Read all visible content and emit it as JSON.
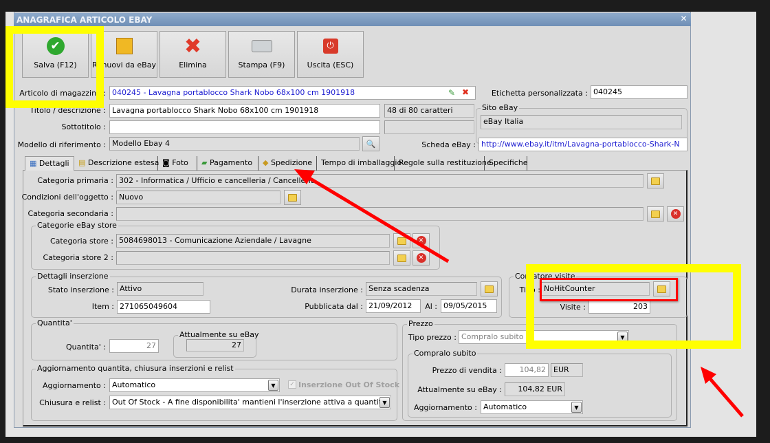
{
  "window": {
    "title": "ANAGRAFICA ARTICOLO EBAY",
    "close": "✕"
  },
  "toolbar": [
    {
      "label": "Salva (F12)",
      "icon": "check-icon"
    },
    {
      "label": "Rimuovi da eBay",
      "icon": "box-remove-icon"
    },
    {
      "label": "Elimina",
      "icon": "x-icon"
    },
    {
      "label": "Stampa (F9)",
      "icon": "printer-icon"
    },
    {
      "label": "Uscita (ESC)",
      "icon": "power-icon"
    }
  ],
  "header": {
    "articolo_label": "Articolo di magazzino :",
    "articolo_value": "040245 - Lavagna portablocco Shark Nobo 68x100 cm 1901918",
    "titolo_label": "Titolo / descrizione :",
    "titolo_value": "Lavagna portablocco Shark Nobo 68x100 cm 1901918",
    "titolo_count": "48 di 80 caratteri",
    "sottotitolo_label": "Sottotitolo :",
    "sottotitolo_value": "",
    "modello_label": "Modello di riferimento :",
    "modello_value": "Modello Ebay 4",
    "etichetta_label": "Etichetta personalizzata :",
    "etichetta_value": "040245",
    "sito_group": "Sito eBay",
    "sito_value": "eBay Italia",
    "scheda_label": "Scheda eBay :",
    "scheda_value": "http://www.ebay.it/itm/Lavagna-portablocco-Shark-N"
  },
  "tabs": [
    "Dettagli",
    "Descrizione estesa",
    "Foto",
    "Pagamento",
    "Spedizione",
    "Tempo di imballaggio",
    "Regole sulla restituzione",
    "Specifiche"
  ],
  "details": {
    "cat_primaria_label": "Categoria primaria :",
    "cat_primaria": "302 - Informatica / Ufficio e cancelleria / Cancelleria",
    "condizioni_label": "Condizioni dell'oggetto :",
    "condizioni": "Nuovo",
    "cat_secondaria_label": "Categoria secondaria :",
    "cat_secondaria": "",
    "store_group": "Categorie eBay store",
    "store_label": "Categoria store :",
    "store": "5084698013 - Comunicazione Aziendale / Lavagne",
    "store2_label": "Categoria store 2 :",
    "store2": "",
    "inserzione_group": "Dettagli inserzione",
    "stato_label": "Stato inserzione :",
    "stato": "Attivo",
    "item_label": "Item :",
    "item": "271065049604",
    "durata_label": "Durata inserzione :",
    "durata": "Senza scadenza",
    "pubblicata_label": "Pubblicata dal :",
    "pubblicata": "21/09/2012",
    "al_label": "Al :",
    "al": "09/05/2015",
    "contatore_group": "Contatore visite",
    "tipo_label": "Tipo :",
    "tipo": "NoHitCounter",
    "visite_label": "Visite :",
    "visite": "203",
    "quantita_group": "Quantita'",
    "quantita_label": "Quantita' :",
    "quantita": "27",
    "attualmente_group": "Attualmente su eBay",
    "attualmente_qty": "27",
    "aggiornamento_group": "Aggiornamento quantita, chiusura inserzioni e relist",
    "aggiornamento_label": "Aggiornamento :",
    "aggiornamento": "Automatico",
    "out_of_stock_label": "Inserzione Out Of Stock",
    "chiusura_label": "Chiusura e relist :",
    "chiusura": "Out Of Stock - A fine disponibilita' mantieni l'inserzione attiva a quantita' zero",
    "prezzo_group": "Prezzo",
    "tipo_prezzo_label": "Tipo prezzo :",
    "tipo_prezzo": "Compralo subito",
    "compralo_group": "Compralo subito",
    "prezzo_vendita_label": "Prezzo di vendita :",
    "prezzo_vendita": "104,82",
    "valuta": "EUR",
    "attualmente_prezzo_label": "Attualmente su eBay :",
    "attualmente_prezzo": "104,82 EUR",
    "agg_prezzo_label": "Aggiornamento :",
    "agg_prezzo": "Automatico"
  },
  "annotation_colors": {
    "highlight": "#ffff00",
    "arrow": "#ff0000"
  }
}
